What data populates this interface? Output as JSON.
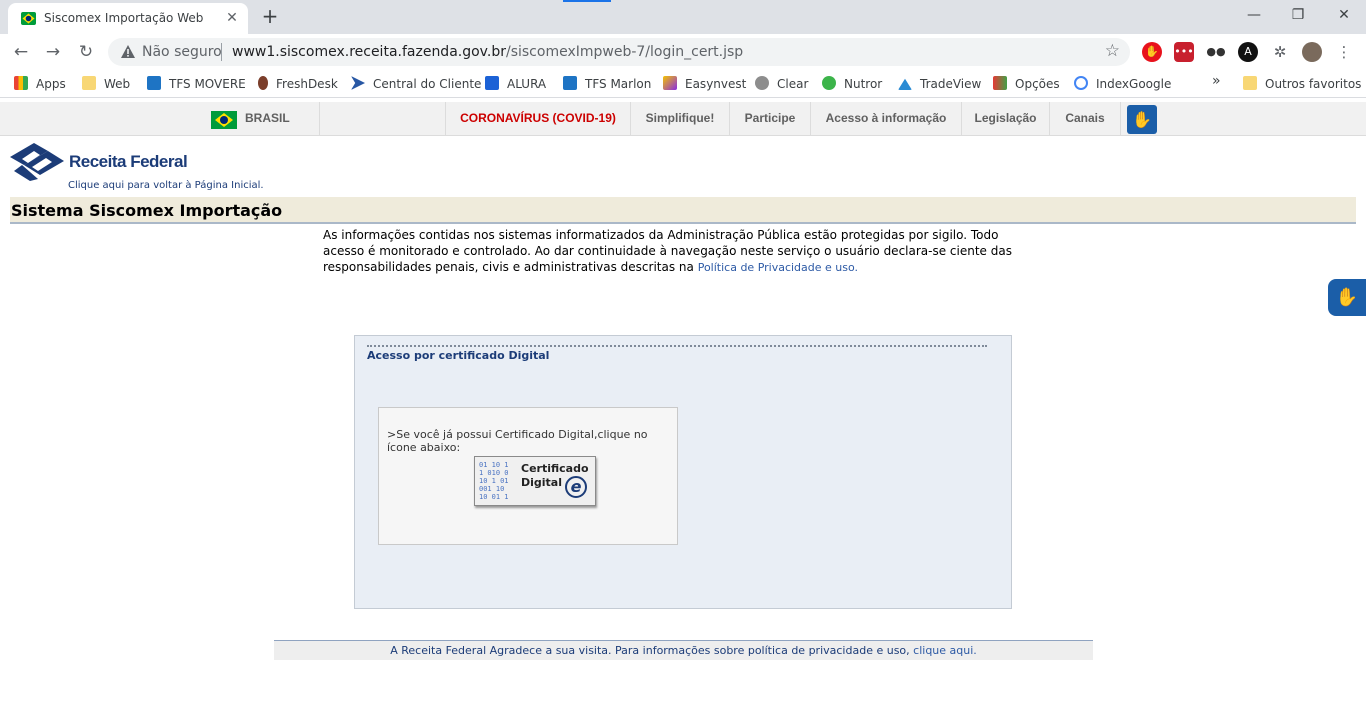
{
  "browser": {
    "tab_title": "Siscomex Importação Web",
    "tab_close": "✕",
    "new_tab": "+",
    "security_label": "Não seguro",
    "url_host": "www1.siscomex.receita.fazenda.gov.br",
    "url_path": "/siscomexImpweb-7/login_cert.jsp",
    "window": {
      "minimize": "—",
      "restore": "❐",
      "close": "✕"
    }
  },
  "bookmarks": {
    "items": [
      {
        "label": "Apps",
        "icon": "apps-grid-icon"
      },
      {
        "label": "Web",
        "icon": "folder-icon"
      },
      {
        "label": "TFS MOVERE",
        "icon": "visual-studio-icon"
      },
      {
        "label": "FreshDesk",
        "icon": "freshdesk-icon"
      },
      {
        "label": "Central do Cliente",
        "icon": "chevron-icon"
      },
      {
        "label": "ALURA",
        "icon": "alura-icon"
      },
      {
        "label": "TFS Marlon",
        "icon": "visual-studio-icon"
      },
      {
        "label": "Easynvest",
        "icon": "easynvest-icon"
      },
      {
        "label": "Clear",
        "icon": "clear-icon"
      },
      {
        "label": "Nutror",
        "icon": "nutror-icon"
      },
      {
        "label": "TradeView",
        "icon": "tradeview-icon"
      },
      {
        "label": "Opções",
        "icon": "opcoes-icon"
      },
      {
        "label": "IndexGoogle",
        "icon": "google-icon"
      }
    ],
    "more": "»",
    "other": "Outros favoritos"
  },
  "govbar": {
    "brasil": "BRASIL",
    "items": [
      "CORONAVÍRUS (COVID-19)",
      "Simplifique!",
      "Participe",
      "Acesso à informação",
      "Legislação",
      "Canais"
    ]
  },
  "header": {
    "logo_text": "Receita Federal",
    "logo_sub": "Clique aqui para voltar à Página Inicial.",
    "system_title": "Sistema Siscomex Importação"
  },
  "notice": {
    "text": "As informações contidas nos sistemas informatizados da Administração Pública estão protegidas por sigilo. Todo acesso é monitorado e controlado. Ao dar continuidade à navegação neste serviço o usuário declara-se ciente das responsabilidades penais, civis e administrativas descritas na",
    "link": "Política de Privacidade e uso."
  },
  "login": {
    "panel_title": "Acesso por certificado Digital",
    "message": ">Se você já possui Certificado Digital,clique no ícone abaixo:",
    "cert_line1": "Certificado",
    "cert_line2": "Digital",
    "cert_badge": "e"
  },
  "footer": {
    "text": "A Receita Federal Agradece a sua visita. Para informações sobre política de privacidade e uso,",
    "link": "clique aqui."
  }
}
